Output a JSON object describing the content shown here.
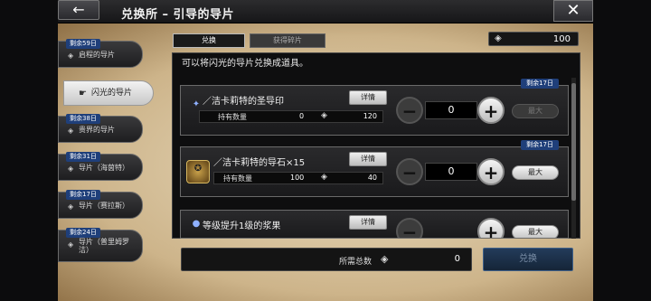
{
  "header": {
    "title": "兑换所 – 引导的导片",
    "back_icon": "←",
    "close_icon": "✕"
  },
  "sidebar": {
    "items": [
      {
        "badge": "剩余59日",
        "icon": "◈",
        "label": "启程的导片"
      },
      {
        "badge": "",
        "icon": "◈",
        "label": "闪光的导片"
      },
      {
        "badge": "剩余38日",
        "icon": "◈",
        "label": "贵界的导片"
      },
      {
        "badge": "剩余31日",
        "icon": "◈",
        "label": "导片（海茵特）"
      },
      {
        "badge": "剩余17日",
        "icon": "◈",
        "label": "导片（赛拉斯）"
      },
      {
        "badge": "剩余24日",
        "icon": "◈",
        "label": "导片（普里姆罗洁）"
      }
    ]
  },
  "tabs": {
    "exchange": "兑换",
    "shards": "获得碎片"
  },
  "currency": {
    "gem": "◈",
    "amount": "100"
  },
  "notice": "可以将闪光的导片兑换成道具。",
  "cards": [
    {
      "tag": "剩余17日",
      "name": "洁卡莉特的圣导印",
      "detail": "详情",
      "own_label": "持有数量",
      "own_value": "0",
      "cost": "120",
      "qty": "0",
      "max": "最大"
    },
    {
      "tag": "剩余17日",
      "name": "洁卡莉特的导石×15",
      "detail": "详情",
      "own_label": "持有数量",
      "own_value": "100",
      "cost": "40",
      "qty": "0",
      "max": "最大"
    },
    {
      "tag": "",
      "name": "等级提升1级的浆果",
      "detail": "详情",
      "own_label": "",
      "own_value": "",
      "cost": "",
      "qty": "",
      "max": "最大"
    }
  ],
  "footer": {
    "total_label": "所需总数",
    "total_gem": "◈",
    "total_value": "0",
    "exchange_button": "兑换"
  }
}
